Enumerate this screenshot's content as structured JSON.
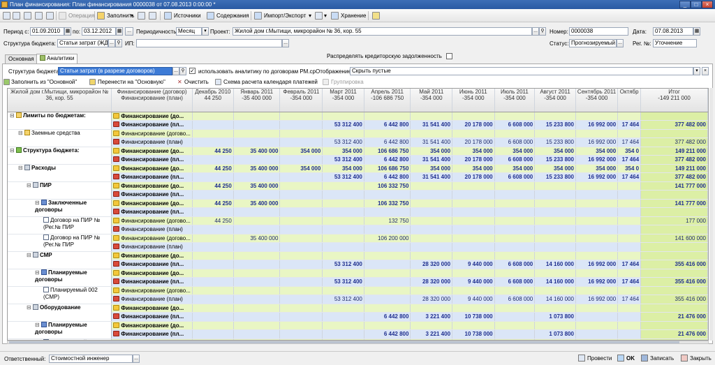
{
  "window": {
    "title": "План финансирования: План финансирования 0000038 от 07.08.2013 0:00:00 *"
  },
  "toolbar": {
    "operation": "Операция",
    "fill": "Заполнить",
    "sources": "Источники",
    "contents": "Содержания",
    "import_export": "Импорт/Экспорт",
    "storage": "Хранение"
  },
  "header": {
    "period_from_label": "Период с:",
    "period_from": "01.09.2010",
    "period_to_label": "по:",
    "period_to": "03.12.2012",
    "periodicity_label": "Периодичность:",
    "periodicity": "Месяц",
    "project_label": "Проект:",
    "project": "Жилой дом г.Мытищи, микрорайон № 36, кор. 55",
    "number_label": "Номер:",
    "number": "0000038",
    "date_label": "Дата:",
    "date": "07.08.2013",
    "budget_structure_label": "Структура бюджета:",
    "budget_structure": "Статьи затрат (ЖД",
    "ip_label": "ИП:",
    "ip": "",
    "status_label": "Статус:",
    "status": "Прогнозируемый",
    "reg_no_label": "Рег. №:",
    "reg_no": "Уточнение",
    "distribute_label": "Распределять кредиторскую задолженность"
  },
  "tabs": [
    "Основная",
    "Аналитики"
  ],
  "analytics": {
    "structure_label": "Структура бюджета:",
    "structure_value": "Статьи затрат (в разрезе договоров)",
    "use_analytics_label": "использовать аналитику по договорам РМ.ср",
    "display_label": "Отображение",
    "display_value": "Скрыть пустые",
    "btn_fill_from_main": "Заполнить из \"Основной\"",
    "btn_move_to_main": "Перенести на \"Основную\"",
    "btn_clear": "Очистить",
    "btn_schedule": "Схема расчета календаря платежей",
    "btn_group": "Группировка"
  },
  "grid": {
    "header_col0": "Жилой дом г.Мытищи, микрорайон № 36, кор. 55",
    "header_col1": [
      "Финансирование (договор)",
      "Финансирование (план)"
    ],
    "months": [
      {
        "name": "Декабрь 2010",
        "total": "44 250"
      },
      {
        "name": "Январь 2011",
        "total": "-35 400 000"
      },
      {
        "name": "Февраль 2011",
        "total": "-354 000"
      },
      {
        "name": "Март 2011",
        "total": "-354 000"
      },
      {
        "name": "Апрель 2011",
        "total": "-106 686 750"
      },
      {
        "name": "Май 2011",
        "total": "-354 000"
      },
      {
        "name": "Июнь 2011",
        "total": "-354 000"
      },
      {
        "name": "Июль 2011",
        "total": "-354 000"
      },
      {
        "name": "Август 2011",
        "total": "-354 000"
      },
      {
        "name": "Сентябрь 2011",
        "total": "-354 000"
      },
      {
        "name": "Октябр",
        "total": ""
      }
    ],
    "total_header": {
      "name": "Итог",
      "total": "-149 211 000"
    },
    "rows": [
      {
        "label": "Лимиты по бюджетам:",
        "indent": 0,
        "kind": "folder-y",
        "bold": true,
        "lines": [
          {
            "type": "Финансирование (до...",
            "icon": "y",
            "bold": true,
            "vals": [
              "",
              "",
              "",
              "",
              "",
              "",
              "",
              "",
              "",
              "",
              ""
            ],
            "total": ""
          },
          {
            "type": "Финансирование (пл...",
            "icon": "r",
            "bold": true,
            "vals": [
              "",
              "",
              "",
              "53 312 400",
              "6 442 800",
              "31 541 400",
              "20 178 000",
              "6 608 000",
              "15 233 800",
              "16 992 000",
              "17 464"
            ],
            "total": "377 482 000"
          }
        ]
      },
      {
        "label": "Заемные средства",
        "indent": 1,
        "kind": "folder-y",
        "bold": false,
        "lines": [
          {
            "type": "Финансирование (догово...",
            "icon": "y",
            "bold": false,
            "vals": [
              "",
              "",
              "",
              "",
              "",
              "",
              "",
              "",
              "",
              "",
              ""
            ],
            "total": ""
          },
          {
            "type": "Финансирование (план)",
            "icon": "r",
            "bold": false,
            "vals": [
              "",
              "",
              "",
              "53 312 400",
              "6 442 800",
              "31 541 400",
              "20 178 000",
              "6 608 000",
              "15 233 800",
              "16 992 000",
              "17 464"
            ],
            "total": "377 482 000"
          }
        ]
      },
      {
        "label": "Структура бюджета:",
        "indent": 0,
        "kind": "folder-g",
        "bold": true,
        "lines": [
          {
            "type": "Финансирование (до...",
            "icon": "y",
            "bold": true,
            "vals": [
              "44 250",
              "35 400 000",
              "354 000",
              "354 000",
              "106 686 750",
              "354 000",
              "354 000",
              "354 000",
              "354 000",
              "354 000",
              "354 0"
            ],
            "total": "149 211 000"
          },
          {
            "type": "Финансирование (пл...",
            "icon": "r",
            "bold": true,
            "vals": [
              "",
              "",
              "",
              "53 312 400",
              "6 442 800",
              "31 541 400",
              "20 178 000",
              "6 608 000",
              "15 233 800",
              "16 992 000",
              "17 464"
            ],
            "total": "377 482 000"
          }
        ]
      },
      {
        "label": "Расходы",
        "indent": 1,
        "kind": "folder",
        "bold": true,
        "lines": [
          {
            "type": "Финансирование (до...",
            "icon": "y",
            "bold": true,
            "vals": [
              "44 250",
              "35 400 000",
              "354 000",
              "354 000",
              "106 686 750",
              "354 000",
              "354 000",
              "354 000",
              "354 000",
              "354 000",
              "354 0"
            ],
            "total": "149 211 000"
          },
          {
            "type": "Финансирование (пл...",
            "icon": "r",
            "bold": true,
            "vals": [
              "",
              "",
              "",
              "53 312 400",
              "6 442 800",
              "31 541 400",
              "20 178 000",
              "6 608 000",
              "15 233 800",
              "16 992 000",
              "17 464"
            ],
            "total": "377 482 000"
          }
        ]
      },
      {
        "label": "ПИР",
        "indent": 2,
        "kind": "folder",
        "bold": true,
        "lines": [
          {
            "type": "Финансирование (до...",
            "icon": "y",
            "bold": true,
            "vals": [
              "44 250",
              "35 400 000",
              "",
              "",
              "106 332 750",
              "",
              "",
              "",
              "",
              "",
              ""
            ],
            "total": "141 777 000"
          },
          {
            "type": "Финансирование (пл...",
            "icon": "r",
            "bold": true,
            "vals": [
              "",
              "",
              "",
              "",
              "",
              "",
              "",
              "",
              "",
              "",
              ""
            ],
            "total": ""
          }
        ]
      },
      {
        "label": "Заключенные договоры",
        "indent": 3,
        "kind": "contract",
        "bold": true,
        "lines": [
          {
            "type": "Финансирование (до...",
            "icon": "y",
            "bold": true,
            "vals": [
              "44 250",
              "35 400 000",
              "",
              "",
              "106 332 750",
              "",
              "",
              "",
              "",
              "",
              ""
            ],
            "total": "141 777 000"
          },
          {
            "type": "Финансирование (пл...",
            "icon": "r",
            "bold": true,
            "vals": [
              "",
              "",
              "",
              "",
              "",
              "",
              "",
              "",
              "",
              "",
              ""
            ],
            "total": ""
          }
        ]
      },
      {
        "label": "Договор на ПИР №  (Рег.№ ПИР",
        "indent": 4,
        "kind": "doc",
        "bold": false,
        "lines": [
          {
            "type": "Финансирование (догово...",
            "icon": "y",
            "bold": false,
            "vals": [
              "44 250",
              "",
              "",
              "",
              "132 750",
              "",
              "",
              "",
              "",
              "",
              ""
            ],
            "total": "177 000"
          },
          {
            "type": "Финансирование (план)",
            "icon": "r",
            "bold": false,
            "vals": [
              "",
              "",
              "",
              "",
              "",
              "",
              "",
              "",
              "",
              "",
              ""
            ],
            "total": ""
          }
        ]
      },
      {
        "label": "Договор на ПИР №  (Рег.№ ПИР",
        "indent": 4,
        "kind": "doc",
        "bold": false,
        "lines": [
          {
            "type": "Финансирование (догово...",
            "icon": "y",
            "bold": false,
            "vals": [
              "",
              "35 400 000",
              "",
              "",
              "106 200 000",
              "",
              "",
              "",
              "",
              "",
              ""
            ],
            "total": "141 600 000"
          },
          {
            "type": "Финансирование (план)",
            "icon": "r",
            "bold": false,
            "vals": [
              "",
              "",
              "",
              "",
              "",
              "",
              "",
              "",
              "",
              "",
              ""
            ],
            "total": ""
          }
        ]
      },
      {
        "label": "СМР",
        "indent": 2,
        "kind": "folder",
        "bold": true,
        "lines": [
          {
            "type": "Финансирование (до...",
            "icon": "y",
            "bold": true,
            "vals": [
              "",
              "",
              "",
              "",
              "",
              "",
              "",
              "",
              "",
              "",
              ""
            ],
            "total": ""
          },
          {
            "type": "Финансирование (пл...",
            "icon": "r",
            "bold": true,
            "vals": [
              "",
              "",
              "",
              "53 312 400",
              "",
              "28 320 000",
              "9 440 000",
              "6 608 000",
              "14 160 000",
              "16 992 000",
              "17 464"
            ],
            "total": "355 416 000"
          }
        ]
      },
      {
        "label": "Планируемые договоры",
        "indent": 3,
        "kind": "contract",
        "bold": true,
        "lines": [
          {
            "type": "Финансирование (до...",
            "icon": "y",
            "bold": true,
            "vals": [
              "",
              "",
              "",
              "",
              "",
              "",
              "",
              "",
              "",
              "",
              ""
            ],
            "total": ""
          },
          {
            "type": "Финансирование (пл...",
            "icon": "r",
            "bold": true,
            "vals": [
              "",
              "",
              "",
              "53 312 400",
              "",
              "28 320 000",
              "9 440 000",
              "6 608 000",
              "14 160 000",
              "16 992 000",
              "17 464"
            ],
            "total": "355 416 000"
          }
        ]
      },
      {
        "label": "Планируемый 002 (СМР)",
        "indent": 4,
        "kind": "doc",
        "bold": false,
        "lines": [
          {
            "type": "Финансирование (догово...",
            "icon": "y",
            "bold": false,
            "vals": [
              "",
              "",
              "",
              "",
              "",
              "",
              "",
              "",
              "",
              "",
              ""
            ],
            "total": ""
          },
          {
            "type": "Финансирование (план)",
            "icon": "r",
            "bold": false,
            "vals": [
              "",
              "",
              "",
              "53 312 400",
              "",
              "28 320 000",
              "9 440 000",
              "6 608 000",
              "14 160 000",
              "16 992 000",
              "17 464"
            ],
            "total": "355 416 000"
          }
        ]
      },
      {
        "label": "Оборудование",
        "indent": 2,
        "kind": "folder",
        "bold": true,
        "lines": [
          {
            "type": "Финансирование (до...",
            "icon": "y",
            "bold": true,
            "vals": [
              "",
              "",
              "",
              "",
              "",
              "",
              "",
              "",
              "",
              "",
              ""
            ],
            "total": ""
          },
          {
            "type": "Финансирование (пл...",
            "icon": "r",
            "bold": true,
            "vals": [
              "",
              "",
              "",
              "",
              "6 442 800",
              "3 221 400",
              "10 738 000",
              "",
              "1 073 800",
              "",
              ""
            ],
            "total": "21 476 000"
          }
        ]
      },
      {
        "label": "Планируемые договоры",
        "indent": 3,
        "kind": "contract",
        "bold": true,
        "lines": [
          {
            "type": "Финансирование (до...",
            "icon": "y",
            "bold": true,
            "vals": [
              "",
              "",
              "",
              "",
              "",
              "",
              "",
              "",
              "",
              "",
              ""
            ],
            "total": ""
          },
          {
            "type": "Финансирование (пл...",
            "icon": "r",
            "bold": true,
            "vals": [
              "",
              "",
              "",
              "",
              "6 442 800",
              "3 221 400",
              "10 738 000",
              "",
              "1 073 800",
              "",
              ""
            ],
            "total": "21 476 000"
          }
        ]
      },
      {
        "label": "Планируемый",
        "indent": 4,
        "kind": "doc",
        "bold": false,
        "lines": [
          {
            "type": "Финансирование (догово...",
            "icon": "y",
            "bold": false,
            "vals": [
              "",
              "",
              "",
              "",
              "",
              "",
              "",
              "",
              "",
              "",
              ""
            ],
            "total": ""
          },
          {
            "type": "Финансирование (план)",
            "icon": "r",
            "bold": false,
            "vals": [
              "",
              "",
              "",
              "",
              "",
              "",
              "",
              "",
              "",
              "",
              ""
            ],
            "total": ""
          }
        ]
      }
    ]
  },
  "footer": {
    "responsible_label": "Ответственный:",
    "responsible": "Стоимостной инженер",
    "post": "Провести",
    "ok": "OK",
    "save": "Записать",
    "close": "Закрыть"
  }
}
